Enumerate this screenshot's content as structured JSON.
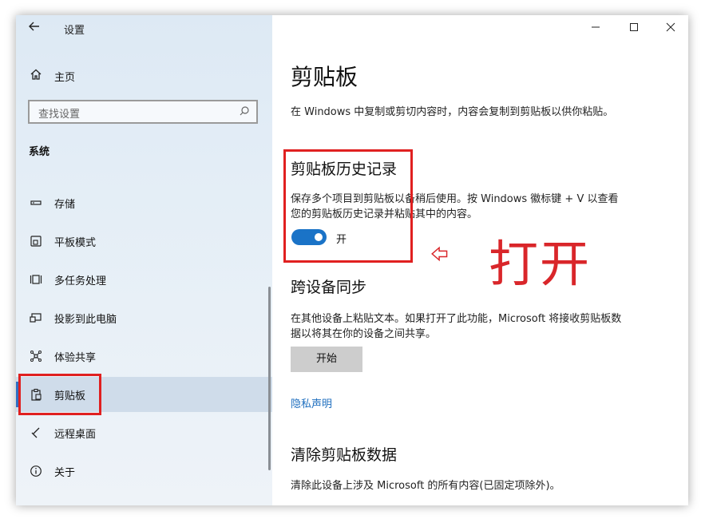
{
  "window": {
    "title": "设置",
    "controls": [
      "minimize",
      "maximize",
      "close"
    ]
  },
  "sidebar": {
    "home_label": "主页",
    "search_placeholder": "查找设置",
    "section_title": "系统",
    "items": [
      {
        "label": "存储",
        "icon": "storage-icon"
      },
      {
        "label": "平板模式",
        "icon": "tablet-icon"
      },
      {
        "label": "多任务处理",
        "icon": "multitask-icon"
      },
      {
        "label": "投影到此电脑",
        "icon": "project-icon"
      },
      {
        "label": "体验共享",
        "icon": "share-icon"
      },
      {
        "label": "剪贴板",
        "icon": "clipboard-icon",
        "selected": true
      },
      {
        "label": "远程桌面",
        "icon": "remote-icon"
      },
      {
        "label": "关于",
        "icon": "info-icon"
      }
    ]
  },
  "main": {
    "title": "剪贴板",
    "intro": "在 Windows 中复制或剪切内容时，内容会复制到剪贴板以供你粘贴。",
    "history": {
      "heading": "剪贴板历史记录",
      "description_line1": "保存多个项目到剪贴板以备稍后使用。按 Windows 徽标键 + V 以查看",
      "description_line2": "您的剪贴板历史记录并粘贴其中的内容。",
      "toggle_state": "开",
      "toggle_on": true
    },
    "sync": {
      "heading": "跨设备同步",
      "description_line1": "在其他设备上粘贴文本。如果打开了此功能，Microsoft 将接收剪贴板数",
      "description_line2": "据以将其在你的设备之间共享。",
      "button_label": "开始"
    },
    "privacy_link": "隐私声明",
    "clear": {
      "heading": "清除剪贴板数据",
      "description": "清除此设备上涉及 Microsoft 的所有内容(已固定项除外)。"
    }
  },
  "annotation": {
    "text": "打开",
    "color": "#d9262a"
  },
  "colors": {
    "accent": "#1a73c7",
    "highlight_box": "#e02020",
    "link": "#1f6fbf"
  }
}
